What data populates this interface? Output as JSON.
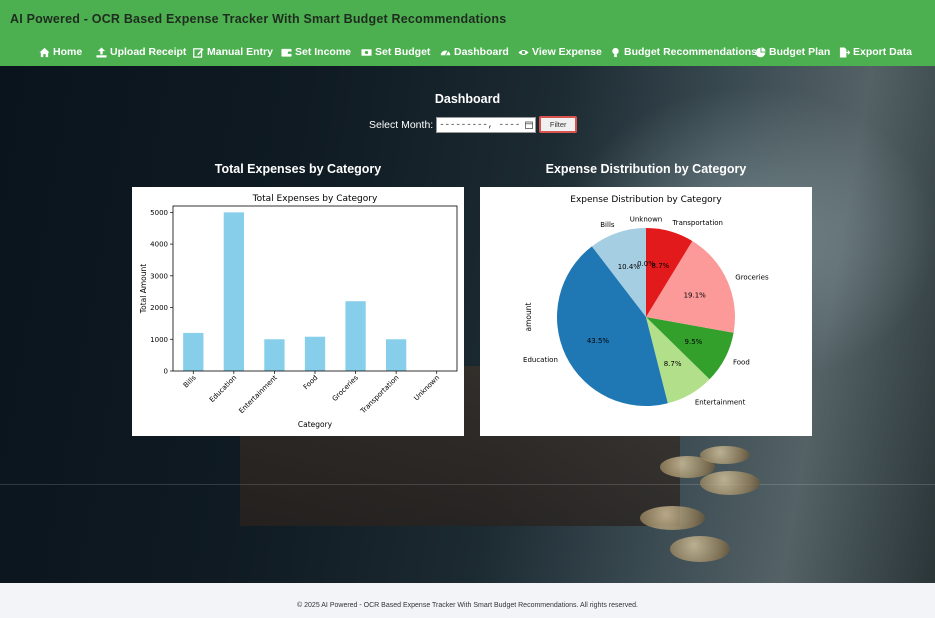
{
  "header": {
    "brand": "AI Powered - OCR Based Expense Tracker With Smart Budget Recommendations",
    "nav": [
      {
        "label": "Home",
        "icon": "home-icon"
      },
      {
        "label": "Upload Receipt",
        "icon": "upload-icon"
      },
      {
        "label": "Manual Entry",
        "icon": "edit-icon"
      },
      {
        "label": "Set Income",
        "icon": "wallet-icon"
      },
      {
        "label": "Set Budget",
        "icon": "money-icon"
      },
      {
        "label": "Dashboard",
        "icon": "gauge-icon"
      },
      {
        "label": "View Expense",
        "icon": "eye-icon"
      },
      {
        "label": "Budget Recommendations",
        "icon": "lightbulb-icon"
      },
      {
        "label": "Budget Plan",
        "icon": "pie-icon"
      },
      {
        "label": "Export Data",
        "icon": "file-export-icon"
      }
    ]
  },
  "dashboard": {
    "title": "Dashboard",
    "month_label": "Select Month:",
    "month_value": "---------, ----",
    "filter_label": "Filter"
  },
  "sections": {
    "bar_title": "Total Expenses by Category",
    "pie_title": "Expense Distribution by Category"
  },
  "chart_data": [
    {
      "type": "bar",
      "title": "Total Expenses by Category",
      "xlabel": "Category",
      "ylabel": "Total Amount",
      "categories": [
        "Bills",
        "Education",
        "Entertainment",
        "Food",
        "Groceries",
        "Transportation",
        "Unknown"
      ],
      "values": [
        1200,
        5000,
        1000,
        1080,
        2200,
        1000,
        0
      ],
      "ylim": [
        0,
        5200
      ],
      "yticks": [
        0,
        1000,
        2000,
        3000,
        4000,
        5000
      ],
      "color": "#87ceeb"
    },
    {
      "type": "pie",
      "title": "Expense Distribution by Category",
      "ylabel": "amount",
      "slices": [
        {
          "label": "Bills",
          "pct_label": "10.4%",
          "value": 10.4,
          "color": "#a6cee3"
        },
        {
          "label": "Education",
          "pct_label": "43.5%",
          "value": 43.5,
          "color": "#1f78b4"
        },
        {
          "label": "Entertainment",
          "pct_label": "8.7%",
          "value": 8.7,
          "color": "#b2df8a"
        },
        {
          "label": "Food",
          "pct_label": "9.5%",
          "value": 9.5,
          "color": "#33a02c"
        },
        {
          "label": "Groceries",
          "pct_label": "19.1%",
          "value": 19.1,
          "color": "#fb9a99"
        },
        {
          "label": "Transportation",
          "pct_label": "8.7%",
          "value": 8.7,
          "color": "#e31a1c"
        },
        {
          "label": "Unknown",
          "pct_label": "0.0%",
          "value": 0.0,
          "color": "#fdbf6f"
        }
      ]
    }
  ],
  "footer": {
    "text": "© 2025 AI Powered - OCR Based Expense Tracker With Smart Budget Recommendations. All rights reserved."
  }
}
